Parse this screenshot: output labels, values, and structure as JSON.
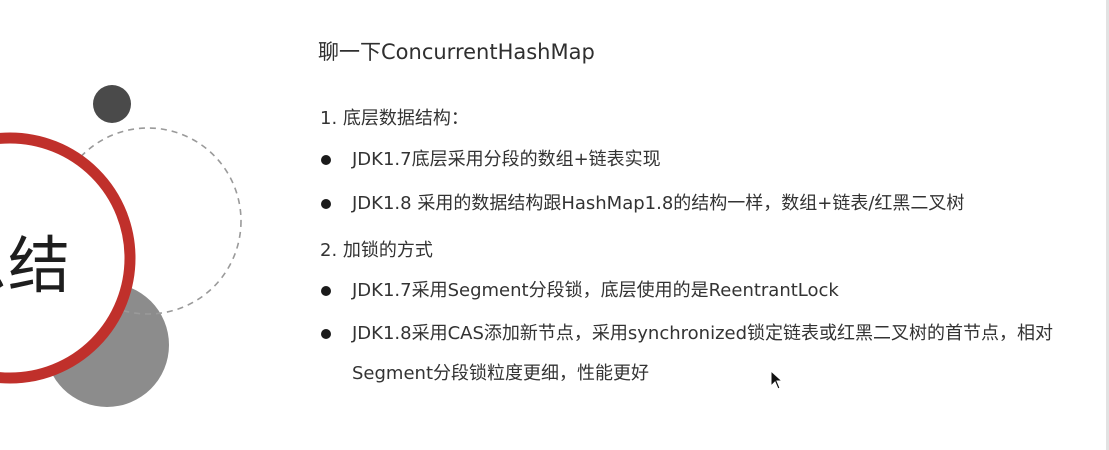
{
  "slide": {
    "title": "聊一下ConcurrentHashMap",
    "summary_heading": "总结",
    "sections": [
      {
        "heading": "1. 底层数据结构：",
        "bullets": [
          "JDK1.7底层采用分段的数组+链表实现",
          "JDK1.8 采用的数据结构跟HashMap1.8的结构一样，数组+链表/红黑二叉树"
        ]
      },
      {
        "heading": "2. 加锁的方式",
        "bullets": [
          "JDK1.7采用Segment分段锁，底层使用的是ReentrantLock",
          "JDK1.8采用CAS添加新节点，采用synchronized锁定链表或红黑二叉树的首节点，相对Segment分段锁粒度更细，性能更好"
        ]
      }
    ]
  },
  "colors": {
    "accent_red": "#c0302b",
    "dark_circle": "#4a4a4a",
    "gray_circle": "#8c8c8c",
    "dashed_circle": "#9a9a9a"
  },
  "icons": {
    "bullet": "filled-circle-bullet-icon",
    "cursor": "mouse-pointer-icon"
  }
}
